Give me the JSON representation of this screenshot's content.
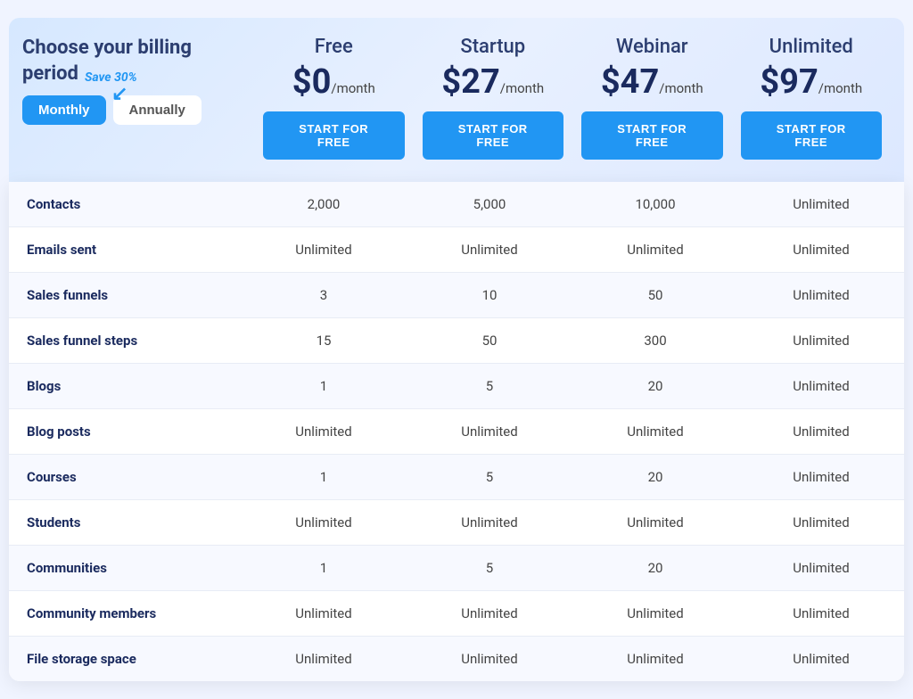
{
  "billing": {
    "title": "Choose your billing period",
    "monthly_label": "Monthly",
    "annually_label": "Annually",
    "save_badge": "Save 30%",
    "active": "monthly"
  },
  "plans": [
    {
      "name": "Free",
      "price_amount": "$0",
      "price_period": "/month",
      "cta": "START FOR FREE"
    },
    {
      "name": "Startup",
      "price_amount": "$27",
      "price_period": "/month",
      "cta": "START FOR FREE"
    },
    {
      "name": "Webinar",
      "price_amount": "$47",
      "price_period": "/month",
      "cta": "START FOR FREE"
    },
    {
      "name": "Unlimited",
      "price_amount": "$97",
      "price_period": "/month",
      "cta": "START FOR FREE"
    }
  ],
  "features": [
    {
      "label": "Contacts",
      "values": [
        "2,000",
        "5,000",
        "10,000",
        "Unlimited"
      ]
    },
    {
      "label": "Emails sent",
      "values": [
        "Unlimited",
        "Unlimited",
        "Unlimited",
        "Unlimited"
      ]
    },
    {
      "label": "Sales funnels",
      "values": [
        "3",
        "10",
        "50",
        "Unlimited"
      ]
    },
    {
      "label": "Sales funnel steps",
      "values": [
        "15",
        "50",
        "300",
        "Unlimited"
      ]
    },
    {
      "label": "Blogs",
      "values": [
        "1",
        "5",
        "20",
        "Unlimited"
      ]
    },
    {
      "label": "Blog posts",
      "values": [
        "Unlimited",
        "Unlimited",
        "Unlimited",
        "Unlimited"
      ]
    },
    {
      "label": "Courses",
      "values": [
        "1",
        "5",
        "20",
        "Unlimited"
      ]
    },
    {
      "label": "Students",
      "values": [
        "Unlimited",
        "Unlimited",
        "Unlimited",
        "Unlimited"
      ]
    },
    {
      "label": "Communities",
      "values": [
        "1",
        "5",
        "20",
        "Unlimited"
      ]
    },
    {
      "label": "Community members",
      "values": [
        "Unlimited",
        "Unlimited",
        "Unlimited",
        "Unlimited"
      ]
    },
    {
      "label": "File storage space",
      "values": [
        "Unlimited",
        "Unlimited",
        "Unlimited",
        "Unlimited"
      ]
    }
  ]
}
